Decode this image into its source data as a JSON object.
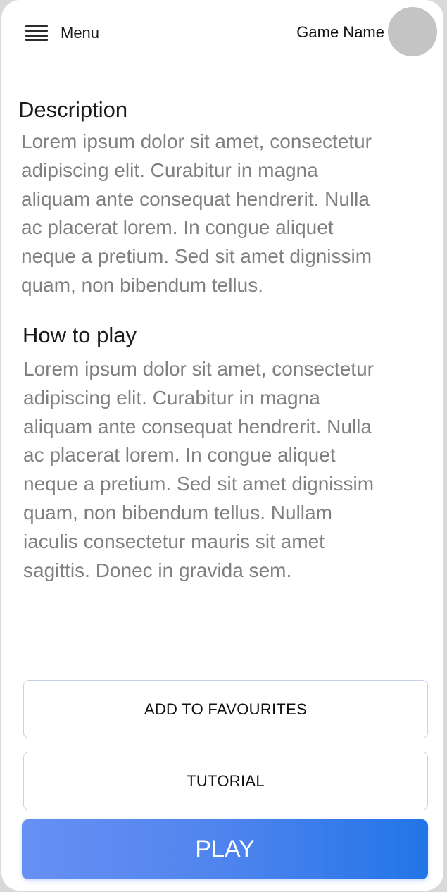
{
  "header": {
    "menu_label": "Menu",
    "menu_icon": "hamburger-icon",
    "game_name": "Game Name"
  },
  "description": {
    "title": "Description",
    "lines": [
      "Lorem ipsum dolor sit amet, consectetur",
      "adipiscing elit. Curabitur in magna",
      "aliquam ante consequat hendrerit. Nulla",
      "ac placerat lorem. In congue aliquet",
      "neque a pretium. Sed sit amet dignissim",
      "quam, non bibendum tellus."
    ]
  },
  "how_to_play": {
    "title": "How to play",
    "lines": [
      "Lorem ipsum dolor sit amet, consectetur",
      "adipiscing elit. Curabitur in magna",
      "aliquam ante consequat hendrerit. Nulla",
      "ac placerat lorem. In congue aliquet",
      "neque a pretium. Sed sit amet dignissim",
      "quam, non bibendum tellus. Nullam",
      "iaculis consectetur mauris sit amet",
      "sagittis. Donec in gravida sem."
    ]
  },
  "buttons": {
    "favourites_label": "ADD TO FAVOURITES",
    "tutorial_label": "TUTORIAL",
    "play_label": "PLAY"
  },
  "colors": {
    "play_gradient_start": "#6790f3",
    "play_gradient_end": "#2275e8",
    "body_text": "#808080",
    "avatar": "#c4c4c4"
  }
}
